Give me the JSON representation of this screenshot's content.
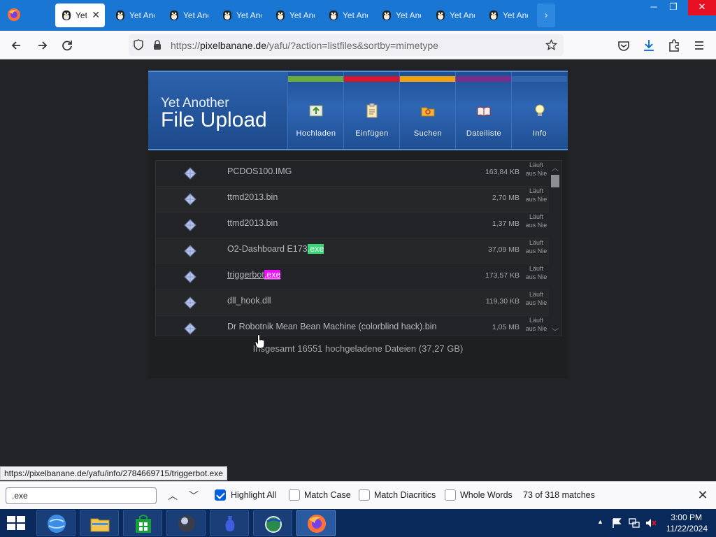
{
  "browser": {
    "tabs": [
      {
        "title": "Yet Another File Upload",
        "active": true
      },
      {
        "title": "Yet Another File Upload",
        "active": false
      },
      {
        "title": "Yet Another File Upload",
        "active": false
      },
      {
        "title": "Yet Another File Upload",
        "active": false
      },
      {
        "title": "Yet Another File Upload",
        "active": false
      },
      {
        "title": "Yet Another File Upload",
        "active": false
      },
      {
        "title": "Yet Another File Upload",
        "active": false
      },
      {
        "title": "Yet Another File Upload",
        "active": false
      },
      {
        "title": "Yet Another File Upload",
        "active": false
      }
    ],
    "tab_scroll_icon": "chevron-right-icon",
    "window_buttons": [
      "minimize",
      "restore",
      "close"
    ],
    "url": {
      "prefix": "https://",
      "host": "pixelbanane.de",
      "path": "/yafu/?action=listfiles&sortby=mimetype"
    }
  },
  "yafu": {
    "brand_line1": "Yet Another",
    "brand_line2": "File Upload",
    "nav": [
      {
        "label": "Hochladen",
        "stripe": "#6aac3a",
        "icon": "upload-icon"
      },
      {
        "label": "Einfügen",
        "stripe": "#d8172e",
        "icon": "clipboard-icon"
      },
      {
        "label": "Suchen",
        "stripe": "#f5a00d",
        "icon": "search-folder-icon"
      },
      {
        "label": "Dateiliste",
        "stripe": "#7a2e8c",
        "icon": "book-icon"
      },
      {
        "label": "Info",
        "stripe": "#2f66ad",
        "icon": "lightbulb-icon"
      }
    ],
    "files": [
      {
        "name": "PCDOS100.IMG",
        "name_match": "",
        "size": "163,84 KB",
        "expiry": "Läuft aus Nie"
      },
      {
        "name": "ttmd2013.bin",
        "name_match": "",
        "size": "2,70 MB",
        "expiry": "Läuft aus Nie"
      },
      {
        "name": "ttmd2013.bin",
        "name_match": "",
        "size": "1,37 MB",
        "expiry": "Läuft aus Nie"
      },
      {
        "name": "O2-Dashboard E173",
        "name_match": ".exe",
        "size": "37,09 MB",
        "expiry": "Läuft aus Nie"
      },
      {
        "name": "triggerbot",
        "name_match": ".exe",
        "size": "173,57 KB",
        "expiry": "Läuft aus Nie"
      },
      {
        "name": "dll_hook.dll",
        "name_match": "",
        "size": "119,30 KB",
        "expiry": "Läuft aus Nie"
      },
      {
        "name": "Dr Robotnik Mean Bean Machine (colorblind hack).bin",
        "name_match": "",
        "size": "1,05 MB",
        "expiry": "Läuft aus Nie"
      }
    ],
    "total": "Insgesamt 16551 hochgeladene Dateien (37,27 GB)"
  },
  "status_link": "https://pixelbanane.de/yafu/info/2784669715/triggerbot.exe",
  "findbar": {
    "query": ".exe",
    "highlight_all": {
      "label": "Highlight All",
      "checked": true
    },
    "match_case": {
      "label": "Match Case",
      "checked": false
    },
    "match_diacritics": {
      "label": "Match Diacritics",
      "checked": false
    },
    "whole_words": {
      "label": "Whole Words",
      "checked": false
    },
    "count": "73 of 318 matches"
  },
  "taskbar": {
    "apps": [
      "ie-globe-icon",
      "file-explorer-icon",
      "store-icon",
      "media-orb-icon",
      "vase-app-icon",
      "globe-app-icon",
      "firefox-icon"
    ],
    "time": "3:00 PM",
    "date": "11/22/2024"
  }
}
